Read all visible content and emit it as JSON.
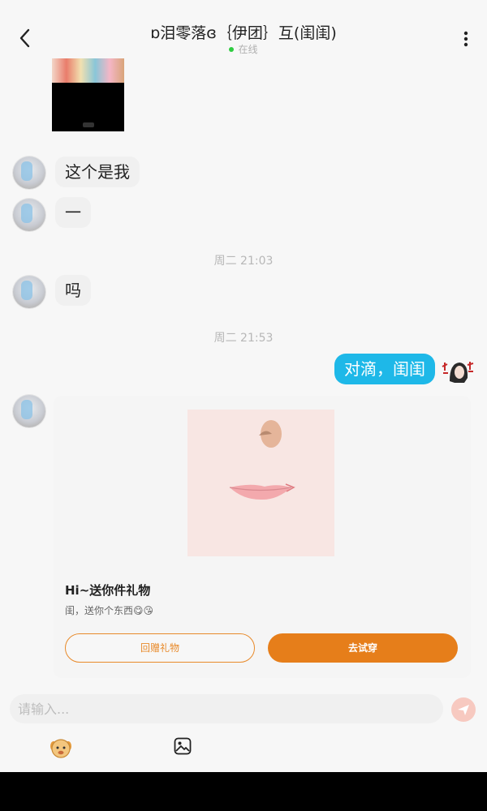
{
  "header": {
    "title": "ɒ泪零落ɞ｛伊团｝互(闺闺)",
    "status": "在线",
    "back_icon": "chevron-left-icon",
    "more_icon": "more-vertical-icon"
  },
  "messages": {
    "m1": "这个是我",
    "m2": "一",
    "ts1": "周二 21:03",
    "m3": "吗",
    "ts2": "周二 21:53",
    "m4": "对滴，闺闺"
  },
  "gift_card": {
    "title": "Hi~送你件礼物",
    "desc": "闺，送你个东西😋😘",
    "return_gift_label": "回赠礼物",
    "try_on_label": "去试穿"
  },
  "composer": {
    "placeholder": "请输入..."
  },
  "colors": {
    "accent_orange": "#e67e1a",
    "bubble_blue": "#1eb8e8",
    "online_green": "#2ecc40"
  }
}
